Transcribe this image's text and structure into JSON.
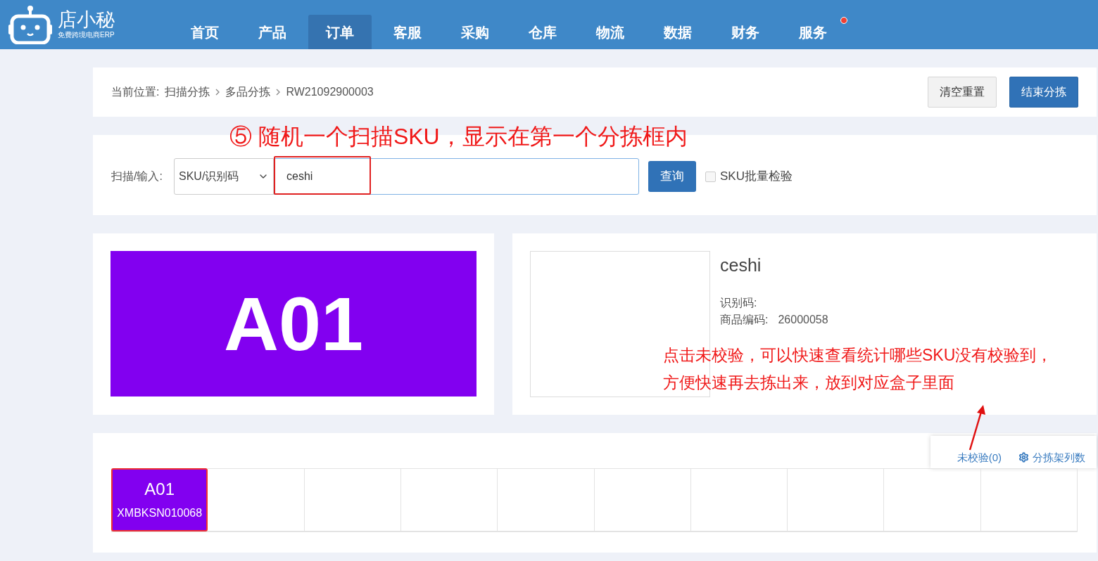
{
  "logo": {
    "name": "店小秘",
    "tagline": "免费跨境电商ERP"
  },
  "nav": [
    {
      "label": "首页",
      "selected": false,
      "badge": false
    },
    {
      "label": "产品",
      "selected": false,
      "badge": false
    },
    {
      "label": "订单",
      "selected": true,
      "badge": false
    },
    {
      "label": "客服",
      "selected": false,
      "badge": false
    },
    {
      "label": "采购",
      "selected": false,
      "badge": false
    },
    {
      "label": "仓库",
      "selected": false,
      "badge": false
    },
    {
      "label": "物流",
      "selected": false,
      "badge": false
    },
    {
      "label": "数据",
      "selected": false,
      "badge": false
    },
    {
      "label": "财务",
      "selected": false,
      "badge": false
    },
    {
      "label": "服务",
      "selected": false,
      "badge": true
    }
  ],
  "breadcrumb": {
    "label": "当前位置:",
    "items": [
      "扫描分拣",
      "多品分拣",
      "RW21092900003"
    ]
  },
  "header_buttons": [
    {
      "label": "清空重置",
      "kind": "default"
    },
    {
      "label": "结束分拣",
      "kind": "primary"
    }
  ],
  "scan": {
    "label": "扫描/输入:",
    "select": "SKU/识别码",
    "value": "ceshi",
    "button": "查询",
    "batch_check": {
      "label": "SKU批量检验",
      "checked": false
    }
  },
  "current_slot": {
    "label": "A01"
  },
  "product": {
    "name": "ceshi",
    "fields": [
      {
        "label": "识别码:"
      },
      {
        "label": "商品编码:",
        "value": "26000058"
      }
    ]
  },
  "shelf_links": {
    "unchecked": "未校验(0)",
    "columns": "分拣架列数"
  },
  "slots": [
    {
      "label": "A01",
      "code": "XMBKSN010068",
      "filled": true
    },
    {
      "filled": false
    },
    {
      "filled": false
    },
    {
      "filled": false
    },
    {
      "filled": false
    },
    {
      "filled": false
    },
    {
      "filled": false
    },
    {
      "filled": false
    },
    {
      "filled": false
    },
    {
      "filled": false
    }
  ],
  "annotations": [
    "⑤ 随机一个扫描SKU，显示在第一个分拣框内",
    "点击未校验，可以快速查看统计哪些SKU没有校验到，",
    "方便快速再去拣出来，放到对应盒子里面"
  ]
}
